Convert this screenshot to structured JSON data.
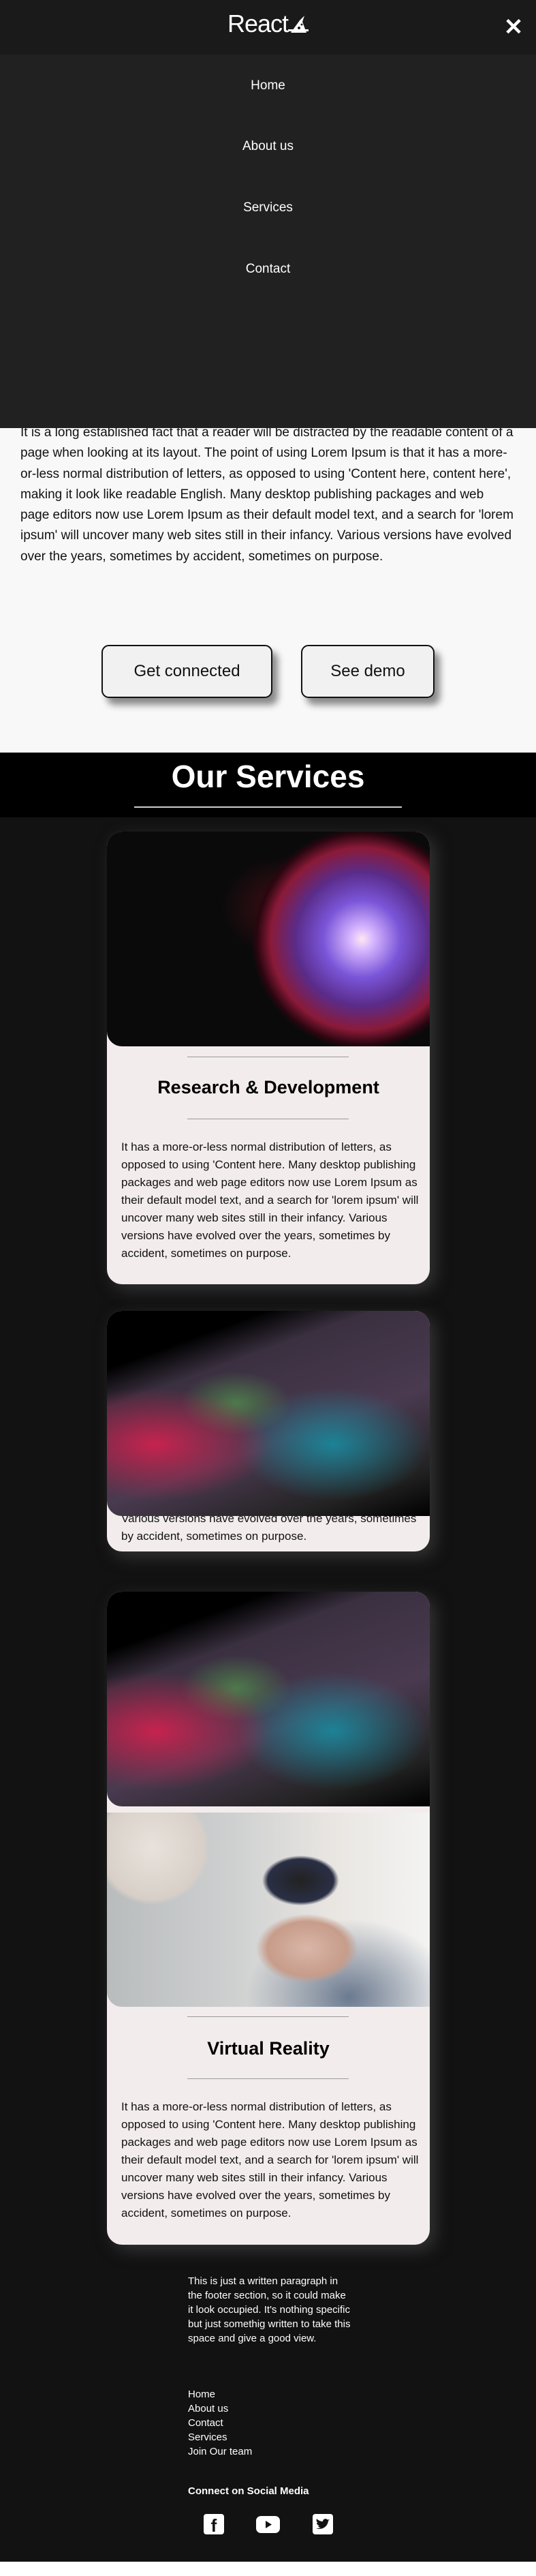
{
  "header": {
    "logo": "React",
    "close_icon": "close-icon"
  },
  "nav": {
    "items": [
      "Home",
      "About us",
      "Services",
      "Contact"
    ]
  },
  "hero": {
    "text": "It is a long established fact that a reader will be distracted by the readable content of a page when looking at its layout. The point of using Lorem Ipsum is that it has a more-or-less normal distribution of letters, as opposed to using 'Content here, content here', making it look like readable English. Many desktop publishing packages and web page editors now use Lorem Ipsum as their default model text, and a search for 'lorem ipsum' will uncover many web sites still in their infancy. Various versions have evolved over the years, sometimes by accident, sometimes on purpose.",
    "buttons": [
      "Get connected",
      "See demo"
    ]
  },
  "services": {
    "title": "Our Services",
    "cards": [
      {
        "title": "Research & Development",
        "text": "It has a more-or-less normal distribution of letters, as opposed to using 'Content here. Many desktop publishing packages and web page editors now use Lorem Ipsum as their default model text, and a search for 'lorem ipsum' will uncover many web sites still in their infancy. Various versions have evolved over the years, sometimes by accident, sometimes on purpose."
      },
      {
        "text": "Various versions have evolved over the years, sometimes by accident, sometimes on purpose."
      },
      {
        "title": "Virtual Reality",
        "text": "It has a more-or-less normal distribution of letters, as opposed to using 'Content here. Many desktop publishing packages and web page editors now use Lorem Ipsum as their default model text, and a search for 'lorem ipsum' will uncover many web sites still in their infancy. Various versions have evolved over the years, sometimes by accident, sometimes on purpose."
      }
    ]
  },
  "footer": {
    "text": "This is just a written paragraph in the footer section, so it could make it look occupied. It's nothing specific but just somethig written to take this space and give a good view.",
    "links": [
      "Home",
      "About us",
      "Contact",
      "Services",
      "Join Our team"
    ],
    "social_heading": "Connect on Social Media",
    "social": [
      "facebook-icon",
      "youtube-icon",
      "twitter-icon"
    ]
  },
  "colors": {
    "header": "#1b1a1a",
    "menu": "#222122",
    "hero_bg": "#f8f8f8",
    "card_bg": "#f3eced",
    "services_bg": "#121212"
  }
}
